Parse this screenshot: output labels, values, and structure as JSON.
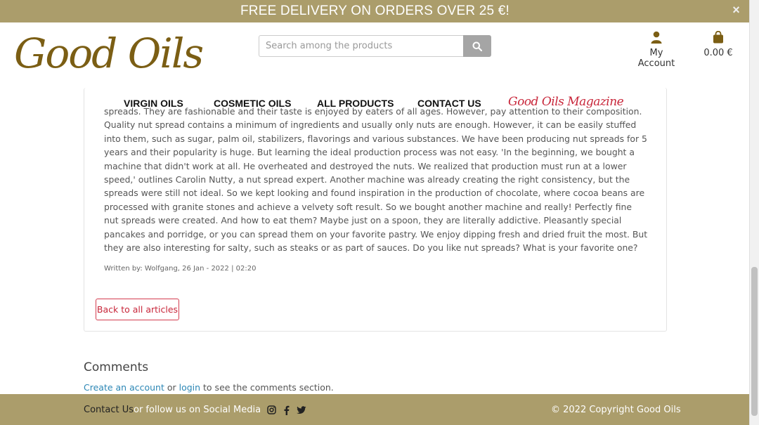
{
  "banner": {
    "text": "FREE DELIVERY ON ORDERS OVER 25 €!",
    "close": "×"
  },
  "logo": {
    "text": "Good Oils"
  },
  "search": {
    "placeholder": "Search among the products",
    "button_icon": "search-icon"
  },
  "account": {
    "label": "My Account",
    "icon": "user-icon"
  },
  "cart": {
    "total": "0.00 €",
    "icon": "shopping-bag-icon"
  },
  "nav": {
    "items": [
      {
        "label": "VIRGIN OILS"
      },
      {
        "label": "COSMETIC OILS"
      },
      {
        "label": "ALL PRODUCTS"
      },
      {
        "label": "CONTACT US"
      }
    ],
    "magazine": "Good Oils Magazine"
  },
  "article": {
    "text": "spreads. They are fashionable and their taste is enjoyed by eaters of all ages. However, pay attention to their composition. Quality nut spread contains a minimum of ingredients and usually only nuts are enough. However, it can be easily stuffed into them, such as sugar, palm oil, stabilizers, flavorings and various substances. We have been producing nut spreads for 5 years and their popularity is huge. But learning the ideal production process was not easy. 'In the beginning, we bought a machine that didn't work at all. He overheated and destroyed the nuts. We realized that production must run at a lower speed,' outlines Carolin Nutty, a nut spread expert. Another machine was already creating the right consistency, but the spreads were still not ideal. So we kept looking and found inspiration in the production of chocolate, where cocoa beans are processed with granite stones and achieve a velvety soft result. So we bought another machine and really! Perfectly fine nut spreads were created. And how to eat them? Maybe just on a spoon, they are literally addictive. Pleasantly special pancakes and porridge, or you can spread them on your favorite pastry. We enjoy dipping fresh and dried fruit the most. But they are also interesting for salty, such as steaks or as part of sauces. Do you like nut spreads? What is your favorite one?",
    "meta": "Written by: Wolfgang, 26 Jan - 2022 | 02:20"
  },
  "back_button": "Back to all articles",
  "comments": {
    "title": "Comments",
    "create_account": "Create an account",
    "or": " or ",
    "login": "login",
    "suffix": " to see the comments section."
  },
  "footer": {
    "contact": "Contact Us",
    "follow": " or follow us on Social Media",
    "social_icons": [
      "instagram-icon",
      "facebook-icon",
      "twitter-icon"
    ],
    "copyright": "© 2022 Copyright Good Oils"
  },
  "colors": {
    "brand": "#ab9d6b",
    "logo": "#7b5e14",
    "accent": "#c8263a",
    "link": "#2c87b5"
  }
}
